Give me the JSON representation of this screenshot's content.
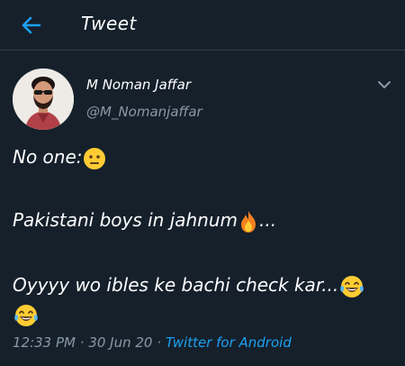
{
  "header": {
    "title": "Tweet",
    "back_icon": "arrow-left-icon"
  },
  "colors": {
    "background": "#15202b",
    "accent": "#1da1f2",
    "secondary_text": "#8899a6",
    "primary_text": "#ffffff"
  },
  "user": {
    "name": "M Noman Jaffar",
    "handle": "@M_Nomanjaffar"
  },
  "tweet": {
    "line1": "No one:",
    "line1_emoji": "neutral-face-emoji",
    "line2": "Pakistani boys in jahnum",
    "line2_emoji": "fire-emoji",
    "line2_suffix": "...",
    "line3": "Oyyyy wo ibles ke bachi check kar...",
    "line3_emoji": "tears-of-joy-emoji",
    "line4_emoji": "tears-of-joy-emoji"
  },
  "meta": {
    "time": "12:33 PM",
    "separator": "·",
    "date": "30 Jun 20",
    "source": "Twitter for Android"
  }
}
